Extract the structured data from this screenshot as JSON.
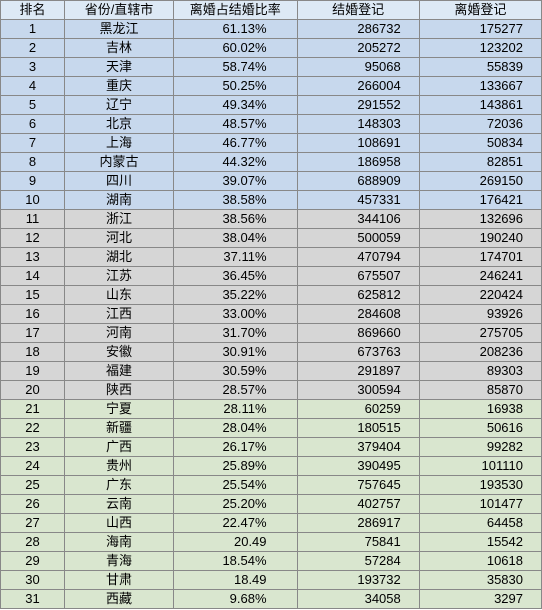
{
  "headers": {
    "rank": "排名",
    "province": "省份/直辖市",
    "ratio": "离婚占结婚比率",
    "marriage": "结婚登记",
    "divorce": "离婚登记"
  },
  "rows": [
    {
      "rank": "1",
      "province": "黑龙江",
      "ratio": "61.13%",
      "marriage": "286732",
      "divorce": "175277",
      "band": "blue"
    },
    {
      "rank": "2",
      "province": "吉林",
      "ratio": "60.02%",
      "marriage": "205272",
      "divorce": "123202",
      "band": "blue"
    },
    {
      "rank": "3",
      "province": "天津",
      "ratio": "58.74%",
      "marriage": "95068",
      "divorce": "55839",
      "band": "blue"
    },
    {
      "rank": "4",
      "province": "重庆",
      "ratio": "50.25%",
      "marriage": "266004",
      "divorce": "133667",
      "band": "blue"
    },
    {
      "rank": "5",
      "province": "辽宁",
      "ratio": "49.34%",
      "marriage": "291552",
      "divorce": "143861",
      "band": "blue"
    },
    {
      "rank": "6",
      "province": "北京",
      "ratio": "48.57%",
      "marriage": "148303",
      "divorce": "72036",
      "band": "blue"
    },
    {
      "rank": "7",
      "province": "上海",
      "ratio": "46.77%",
      "marriage": "108691",
      "divorce": "50834",
      "band": "blue"
    },
    {
      "rank": "8",
      "province": "内蒙古",
      "ratio": "44.32%",
      "marriage": "186958",
      "divorce": "82851",
      "band": "blue"
    },
    {
      "rank": "9",
      "province": "四川",
      "ratio": "39.07%",
      "marriage": "688909",
      "divorce": "269150",
      "band": "blue"
    },
    {
      "rank": "10",
      "province": "湖南",
      "ratio": "38.58%",
      "marriage": "457331",
      "divorce": "176421",
      "band": "blue"
    },
    {
      "rank": "11",
      "province": "浙江",
      "ratio": "38.56%",
      "marriage": "344106",
      "divorce": "132696",
      "band": "gray"
    },
    {
      "rank": "12",
      "province": "河北",
      "ratio": "38.04%",
      "marriage": "500059",
      "divorce": "190240",
      "band": "gray"
    },
    {
      "rank": "13",
      "province": "湖北",
      "ratio": "37.11%",
      "marriage": "470794",
      "divorce": "174701",
      "band": "gray"
    },
    {
      "rank": "14",
      "province": "江苏",
      "ratio": "36.45%",
      "marriage": "675507",
      "divorce": "246241",
      "band": "gray"
    },
    {
      "rank": "15",
      "province": "山东",
      "ratio": "35.22%",
      "marriage": "625812",
      "divorce": "220424",
      "band": "gray"
    },
    {
      "rank": "16",
      "province": "江西",
      "ratio": "33.00%",
      "marriage": "284608",
      "divorce": "93926",
      "band": "gray"
    },
    {
      "rank": "17",
      "province": "河南",
      "ratio": "31.70%",
      "marriage": "869660",
      "divorce": "275705",
      "band": "gray"
    },
    {
      "rank": "18",
      "province": "安徽",
      "ratio": "30.91%",
      "marriage": "673763",
      "divorce": "208236",
      "band": "gray"
    },
    {
      "rank": "19",
      "province": "福建",
      "ratio": "30.59%",
      "marriage": "291897",
      "divorce": "89303",
      "band": "gray"
    },
    {
      "rank": "20",
      "province": "陕西",
      "ratio": "28.57%",
      "marriage": "300594",
      "divorce": "85870",
      "band": "gray"
    },
    {
      "rank": "21",
      "province": "宁夏",
      "ratio": "28.11%",
      "marriage": "60259",
      "divorce": "16938",
      "band": "green"
    },
    {
      "rank": "22",
      "province": "新疆",
      "ratio": "28.04%",
      "marriage": "180515",
      "divorce": "50616",
      "band": "green"
    },
    {
      "rank": "23",
      "province": "广西",
      "ratio": "26.17%",
      "marriage": "379404",
      "divorce": "99282",
      "band": "green"
    },
    {
      "rank": "24",
      "province": "贵州",
      "ratio": "25.89%",
      "marriage": "390495",
      "divorce": "101110",
      "band": "green"
    },
    {
      "rank": "25",
      "province": "广东",
      "ratio": "25.54%",
      "marriage": "757645",
      "divorce": "193530",
      "band": "green"
    },
    {
      "rank": "26",
      "province": "云南",
      "ratio": "25.20%",
      "marriage": "402757",
      "divorce": "101477",
      "band": "green"
    },
    {
      "rank": "27",
      "province": "山西",
      "ratio": "22.47%",
      "marriage": "286917",
      "divorce": "64458",
      "band": "green"
    },
    {
      "rank": "28",
      "province": "海南",
      "ratio": "20.49",
      "marriage": "75841",
      "divorce": "15542",
      "band": "green"
    },
    {
      "rank": "29",
      "province": "青海",
      "ratio": "18.54%",
      "marriage": "57284",
      "divorce": "10618",
      "band": "green"
    },
    {
      "rank": "30",
      "province": "甘肃",
      "ratio": "18.49",
      "marriage": "193732",
      "divorce": "35830",
      "band": "green"
    },
    {
      "rank": "31",
      "province": "西藏",
      "ratio": "9.68%",
      "marriage": "34058",
      "divorce": "3297",
      "band": "green"
    }
  ]
}
